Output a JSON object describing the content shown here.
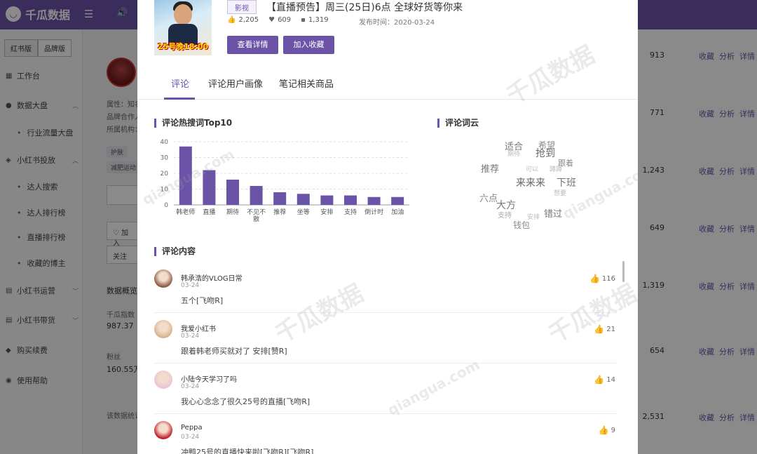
{
  "app": {
    "name": "千瓜数据",
    "logo_glyph": "◡",
    "menu_icon": "☰",
    "sound_icon": "🔊"
  },
  "sidebar": {
    "version_tabs": [
      "红书版",
      "品牌版"
    ],
    "items": [
      {
        "icon": "▦",
        "label": "工作台"
      },
      {
        "icon": "●",
        "label": "数据大盘",
        "chevron": "︿"
      },
      {
        "sub": true,
        "label": "行业流量大盘"
      },
      {
        "icon": "◈",
        "label": "小红书投放",
        "chevron": "︿"
      },
      {
        "sub": true,
        "label": "达人搜索"
      },
      {
        "sub": true,
        "label": "达人排行榜"
      },
      {
        "sub": true,
        "label": "直播排行榜"
      },
      {
        "sub": true,
        "label": "收藏的博主"
      },
      {
        "icon": "▤",
        "label": "小红书运营",
        "chevron": "﹀"
      },
      {
        "icon": "▤",
        "label": "小红书带货",
        "chevron": "﹀"
      },
      {
        "icon": "◆",
        "label": "购买续费"
      },
      {
        "icon": "◉",
        "label": "使用帮助"
      }
    ]
  },
  "background": {
    "fields": [
      "属性：知名",
      "品牌合作人",
      "所属机构："
    ],
    "tags": [
      "护肤",
      "减肥运动"
    ],
    "buttons": [
      "♡ 加入",
      "关注"
    ],
    "data_overview": "数据概览",
    "index_label": "千瓜指数",
    "index_value": "987.37",
    "fans_label": "粉丝",
    "fans_value": "160.55万",
    "note": "该数据统计"
  },
  "right_rows": [
    {
      "value": "913",
      "links": [
        "收藏",
        "分析",
        "详情"
      ]
    },
    {
      "value": "771",
      "links": [
        "收藏",
        "分析",
        "详情"
      ]
    },
    {
      "value": "1,243",
      "links": [
        "收藏",
        "分析",
        "详情"
      ]
    },
    {
      "value": "649",
      "links": [
        "收藏",
        "分析",
        "详情"
      ]
    },
    {
      "value": "1,319",
      "links": [
        "收藏",
        "分析",
        "详情"
      ]
    },
    {
      "value": "654",
      "links": [
        "收藏",
        "分析",
        "详情"
      ]
    },
    {
      "value": "2,531",
      "links": [
        "收藏",
        "分析",
        "详情"
      ]
    }
  ],
  "modal": {
    "cover_text": "25号晚18:00",
    "type_badge": "影视",
    "title": "【直播预告】周三(25日)6点 全球好货等你来",
    "stats": {
      "likes": "2,205",
      "collects": "609",
      "comments": "1,319"
    },
    "publish_time": "发布时间：2020-03-24",
    "btn_detail": "查看详情",
    "btn_collect": "加入收藏",
    "tabs": [
      "评论",
      "评论用户画像",
      "笔记相关商品"
    ],
    "hot_title": "评论热搜词Top10",
    "cloud_title": "评论词云",
    "comments_title": "评论内容"
  },
  "chart_data": {
    "type": "bar",
    "title": "评论热搜词Top10",
    "categories": [
      "韩老师",
      "直播",
      "期待",
      "不见不散",
      "推荐",
      "坐等",
      "安排",
      "支持",
      "倒计时",
      "加油"
    ],
    "values": [
      37,
      22,
      16,
      12,
      8,
      7,
      6,
      6,
      5,
      5
    ],
    "ylim": [
      0,
      40
    ],
    "yticks": [
      0,
      10,
      20,
      30,
      40
    ],
    "color": "#6b53a8",
    "grid": true
  },
  "word_cloud": [
    {
      "text": "适合",
      "size": 13,
      "color": "#777"
    },
    {
      "text": "希望",
      "size": 12,
      "color": "#888"
    },
    {
      "text": "抢到",
      "size": 14,
      "color": "#666"
    },
    {
      "text": "跟着",
      "size": 11,
      "color": "#888"
    },
    {
      "text": "推荐",
      "size": 13,
      "color": "#777"
    },
    {
      "text": "来来来",
      "size": 14,
      "color": "#666"
    },
    {
      "text": "下班",
      "size": 14,
      "color": "#777"
    },
    {
      "text": "六点",
      "size": 13,
      "color": "#888"
    },
    {
      "text": "大方",
      "size": 14,
      "color": "#777"
    },
    {
      "text": "支持",
      "size": 10,
      "color": "#aaa"
    },
    {
      "text": "错过",
      "size": 13,
      "color": "#777"
    },
    {
      "text": "钱包",
      "size": 12,
      "color": "#888"
    },
    {
      "text": "可以",
      "size": 9,
      "color": "#bbb"
    },
    {
      "text": "期待",
      "size": 9,
      "color": "#bbb"
    },
    {
      "text": "想要",
      "size": 9,
      "color": "#bbb"
    },
    {
      "text": "安排",
      "size": 9,
      "color": "#bbb"
    },
    {
      "text": "蹲蹲",
      "size": 9,
      "color": "#bbb"
    }
  ],
  "comments": [
    {
      "user": "韩承浩的VLOG日常",
      "date": "03-24",
      "text": "五个[飞吻R]",
      "likes": "116",
      "av": "#8a5a44"
    },
    {
      "user": "我爱小红书",
      "date": "03-24",
      "text": "跟着韩老师买就对了 安排[赞R]",
      "likes": "21",
      "av": "#d9b28a"
    },
    {
      "user": "小陆今天学习了吗",
      "date": "03-24",
      "text": "我心心念念了很久25号的直播[飞吻R]",
      "likes": "14",
      "av": "#e8c4d6"
    },
    {
      "user": "Peppa",
      "date": "03-24",
      "text": "冲鸭25号的直播快来啦[飞吻R][飞吻R]",
      "likes": "9",
      "av": "#c0202a"
    }
  ],
  "watermarks": [
    "千瓜数据",
    "qiangua.com"
  ]
}
